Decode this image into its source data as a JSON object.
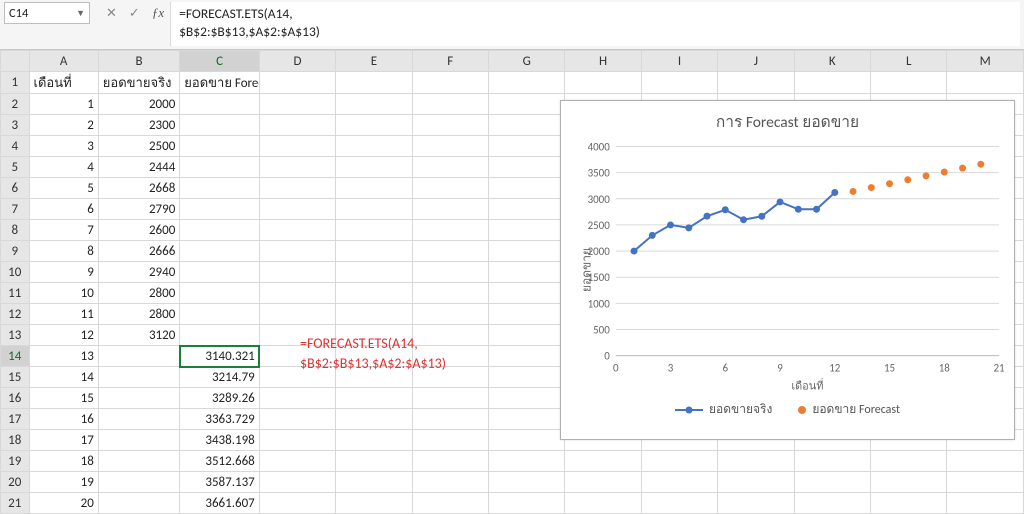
{
  "formula_bar": {
    "cell_ref": "C14",
    "formula_lines": "=FORECAST.ETS(A14,\n$B$2:$B$13,$A$2:$A$13)"
  },
  "columns": [
    "A",
    "B",
    "C",
    "D",
    "E",
    "F",
    "G",
    "H",
    "I",
    "J",
    "K",
    "L",
    "M"
  ],
  "headers": {
    "a": "เดือนที่",
    "b": "ยอดขายจริง",
    "c": "ยอดขาย Forecast"
  },
  "rows": [
    {
      "n": 1,
      "a": 1,
      "b": 2000,
      "c": ""
    },
    {
      "n": 2,
      "a": 2,
      "b": 2300,
      "c": ""
    },
    {
      "n": 3,
      "a": 3,
      "b": 2500,
      "c": ""
    },
    {
      "n": 4,
      "a": 4,
      "b": 2444,
      "c": ""
    },
    {
      "n": 5,
      "a": 5,
      "b": 2668,
      "c": ""
    },
    {
      "n": 6,
      "a": 6,
      "b": 2790,
      "c": ""
    },
    {
      "n": 7,
      "a": 7,
      "b": 2600,
      "c": ""
    },
    {
      "n": 8,
      "a": 8,
      "b": 2666,
      "c": ""
    },
    {
      "n": 9,
      "a": 9,
      "b": 2940,
      "c": ""
    },
    {
      "n": 10,
      "a": 10,
      "b": 2800,
      "c": ""
    },
    {
      "n": 11,
      "a": 11,
      "b": 2800,
      "c": ""
    },
    {
      "n": 12,
      "a": 12,
      "b": 3120,
      "c": ""
    },
    {
      "n": 13,
      "a": 13,
      "b": "",
      "c": "3140.321"
    },
    {
      "n": 14,
      "a": 14,
      "b": "",
      "c": "3214.79"
    },
    {
      "n": 15,
      "a": 15,
      "b": "",
      "c": "3289.26"
    },
    {
      "n": 16,
      "a": 16,
      "b": "",
      "c": "3363.729"
    },
    {
      "n": 17,
      "a": 17,
      "b": "",
      "c": "3438.198"
    },
    {
      "n": 18,
      "a": 18,
      "b": "",
      "c": "3512.668"
    },
    {
      "n": 19,
      "a": 19,
      "b": "",
      "c": "3587.137"
    },
    {
      "n": 20,
      "a": 20,
      "b": "",
      "c": "3661.607"
    }
  ],
  "selected_cell": "C14",
  "overlay_formula": "=FORECAST.ETS(A14,\n$B$2:$B$13,$A$2:$A$13)",
  "chart_data": {
    "type": "line+scatter",
    "title": "การ Forecast ยอดขาย",
    "xlabel": "เดือนที่",
    "ylabel": "ยอดขาย",
    "x_ticks": [
      0,
      3,
      6,
      9,
      12,
      15,
      18,
      21
    ],
    "y_ticks": [
      0,
      500,
      1000,
      1500,
      2000,
      2500,
      3000,
      3500,
      4000
    ],
    "xlim": [
      0,
      21
    ],
    "ylim": [
      0,
      4000
    ],
    "series": [
      {
        "name": "ยอดขายจริง",
        "style": "line-with-markers",
        "color": "#4472c4",
        "x": [
          1,
          2,
          3,
          4,
          5,
          6,
          7,
          8,
          9,
          10,
          11,
          12
        ],
        "y": [
          2000,
          2300,
          2500,
          2444,
          2668,
          2790,
          2600,
          2666,
          2940,
          2800,
          2800,
          3120
        ]
      },
      {
        "name": "ยอดขาย Forecast",
        "style": "markers",
        "color": "#ed7d31",
        "x": [
          13,
          14,
          15,
          16,
          17,
          18,
          19,
          20
        ],
        "y": [
          3140.321,
          3214.79,
          3289.26,
          3363.729,
          3438.198,
          3512.668,
          3587.137,
          3661.607
        ]
      }
    ]
  }
}
